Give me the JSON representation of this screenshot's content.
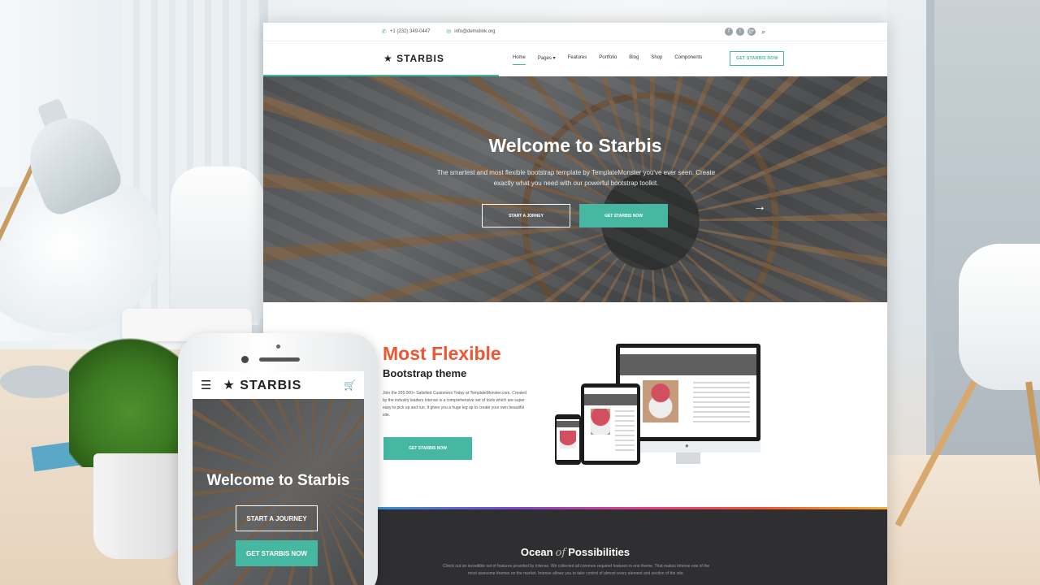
{
  "colors": {
    "accent": "#46b7a1",
    "headline_orange": "#ee5532",
    "dark_section": "#2f2f31"
  },
  "desktop": {
    "topbar": {
      "phone_icon": "phone-icon",
      "phone": "+1 (232) 349-0447",
      "email_icon": "mail-icon",
      "email": "info@demolink.org",
      "social": [
        "f",
        "t",
        "g+"
      ],
      "search_icon": "search-icon"
    },
    "nav": {
      "logo": "★ STARBIS",
      "items": [
        "Home",
        "Pages",
        "Features",
        "Portfolio",
        "Blog",
        "Shop",
        "Components"
      ],
      "cta": "GET STARBIS NOW"
    },
    "hero": {
      "title": "Welcome to Starbis",
      "subtitle": "The smartest and most flexible bootstrap template by TemplateMonster you've ever seen. Create exactly what you need with our powerful bootstrap toolkit.",
      "btn_primary": "START A JORNEY",
      "btn_secondary": "GET STARBIS NOW",
      "next_icon": "arrow-right-icon",
      "next_glyph": "→"
    },
    "feature": {
      "title": "Most Flexible",
      "subtitle": "Bootstrap theme",
      "text": "Join the 205,000+ Satisfied Customers Today at TemplateMonster.com. Created by the industry leaders Intense is a comprehensive set of tools which are super easy to pick up and run. It gives you a huge leg up to create your own beautiful site.",
      "button": "GET STARBIS NOW"
    },
    "ocean": {
      "title_a": "Ocean",
      "title_of": "of",
      "title_b": "Possibilities",
      "text": "Check out an incredible set of features provided by Intense. We collected all common required features in one theme. That makes Intense one of the most awesome themes on the market. Intense allows you to take control of almost every element and section of the site."
    }
  },
  "mobile": {
    "menu_glyph": "☰",
    "logo": "★ STARBIS",
    "cart_glyph": "🛒",
    "hero_title": "Welcome to Starbis",
    "btn_primary": "START A JOURNEY",
    "btn_secondary": "GET STARBIS NOW"
  }
}
